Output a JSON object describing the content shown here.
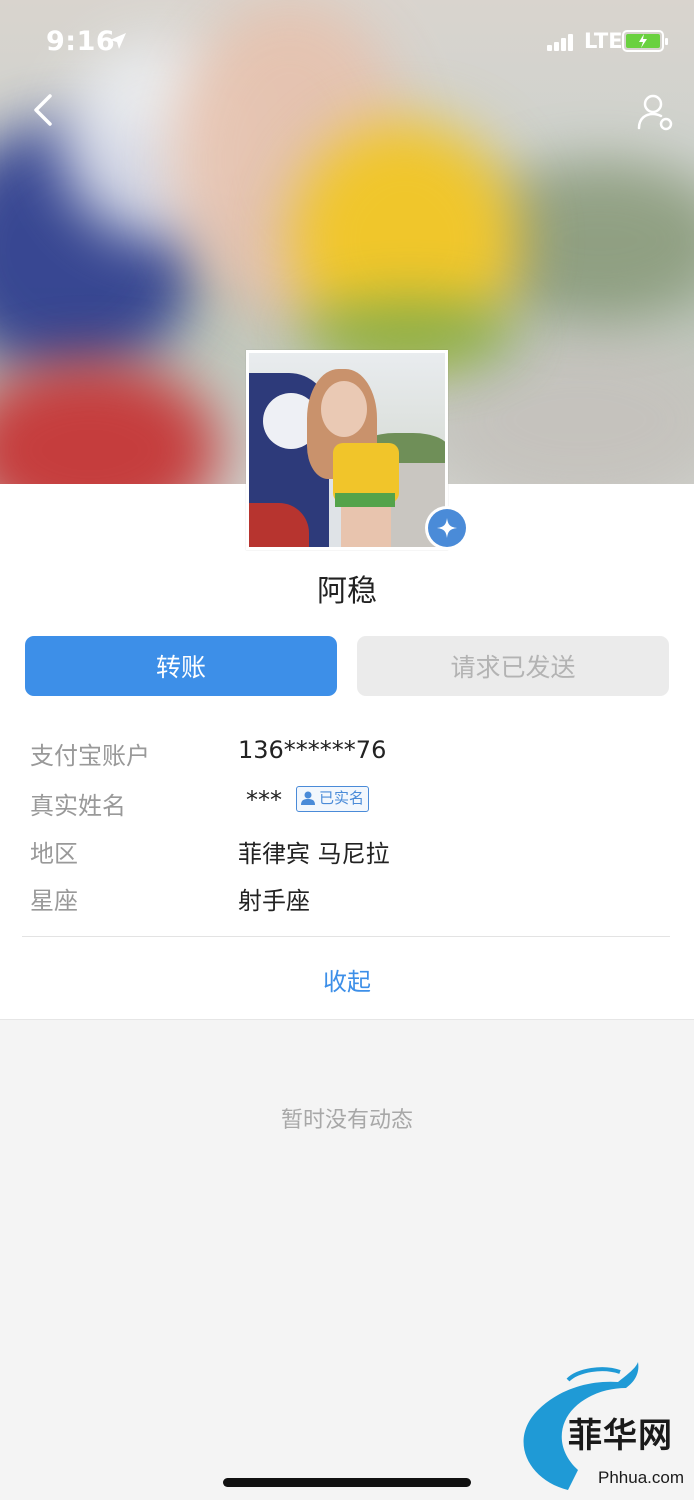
{
  "status_bar": {
    "time": "9:16",
    "network": "LTE",
    "icons": [
      "location-arrow-icon",
      "signal-icon",
      "battery-charging-icon"
    ],
    "battery_color": "#6ad13f"
  },
  "nav": {
    "back_icon": "chevron-left-icon",
    "profile_icon": "user-settings-icon"
  },
  "profile": {
    "name": "阿稳",
    "verified_badge_icon": "diamond-star-icon"
  },
  "actions": {
    "transfer_label": "转账",
    "request_label": "请求已发送"
  },
  "info": {
    "rows": [
      {
        "key": "支付宝账户",
        "value": "136******76"
      },
      {
        "key": "真实姓名",
        "value": "***",
        "badge": "已实名"
      },
      {
        "key": "地区",
        "value": "菲律宾 马尼拉"
      },
      {
        "key": "星座",
        "value": "射手座"
      }
    ],
    "collapse_label": "收起"
  },
  "feed": {
    "empty_text": "暂时没有动态"
  },
  "watermark": {
    "title": "菲华网",
    "url": "Phhua.com"
  },
  "colors": {
    "accent": "#3d8fe8",
    "disabled_button": "#ebebeb",
    "muted_text": "#999999"
  }
}
